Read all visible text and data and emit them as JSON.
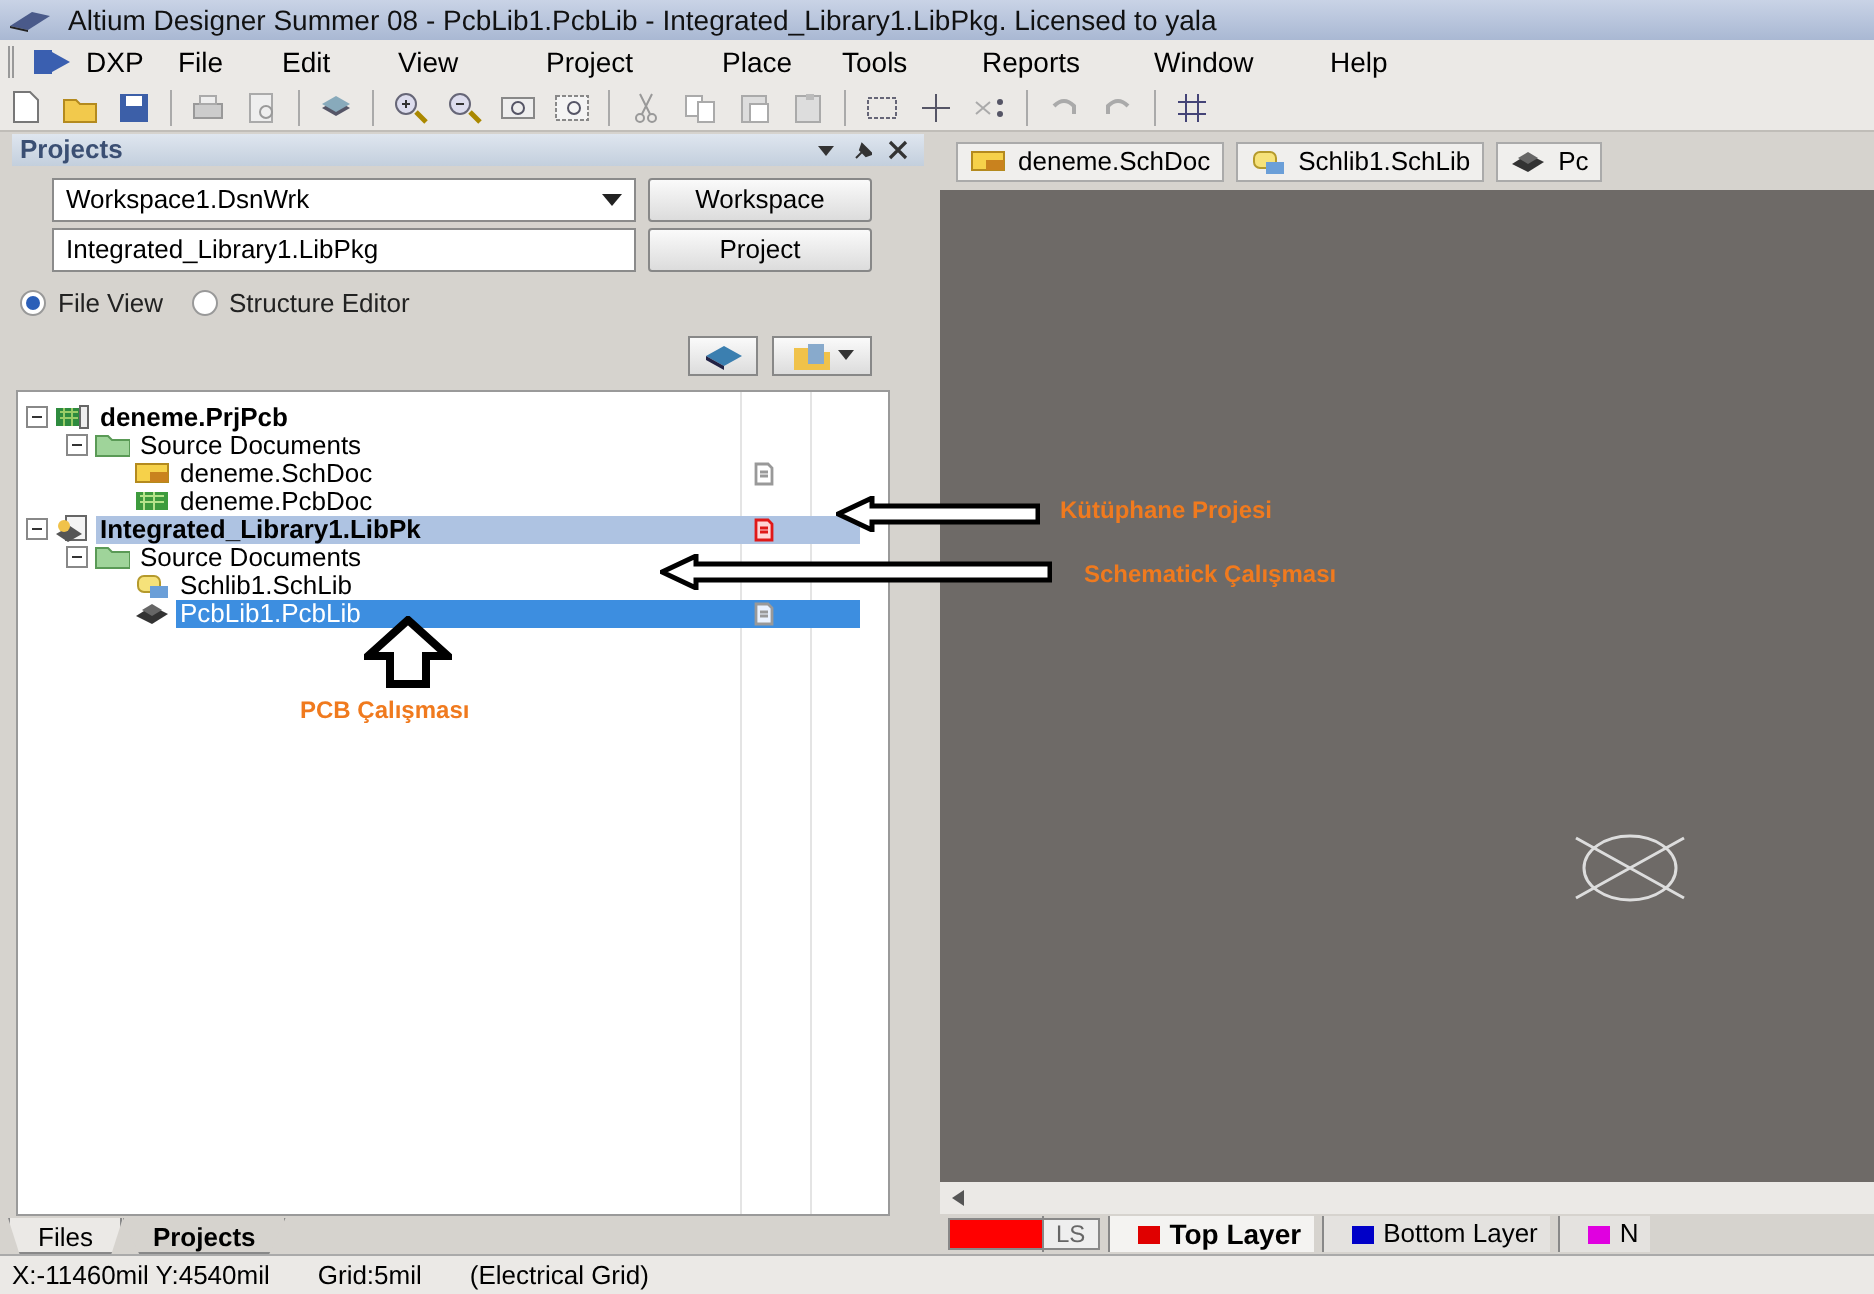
{
  "window": {
    "title": "Altium Designer Summer 08 - PcbLib1.PcbLib - Integrated_Library1.LibPkg. Licensed to yala"
  },
  "menu": [
    "DXP",
    "File",
    "Edit",
    "View",
    "Project",
    "Place",
    "Tools",
    "Reports",
    "Window",
    "Help"
  ],
  "panel": {
    "title": "Projects",
    "workspace_field": "Workspace1.DsnWrk",
    "workspace_button": "Workspace",
    "project_field": "Integrated_Library1.LibPkg",
    "project_button": "Project",
    "view_options": [
      {
        "label": "File View",
        "selected": true
      },
      {
        "label": "Structure Editor",
        "selected": false
      }
    ],
    "tree": [
      {
        "label": "deneme.PrjPcb",
        "kind": "pcb-project",
        "bold": true,
        "expanded": true,
        "selected": false,
        "highlighted": false,
        "open": false,
        "modified": false,
        "children": [
          {
            "label": "Source Documents",
            "kind": "folder",
            "bold": false,
            "expanded": true,
            "selected": false,
            "highlighted": false,
            "open": false,
            "modified": false,
            "children": [
              {
                "label": "deneme.SchDoc",
                "kind": "schdoc",
                "bold": false,
                "selected": false,
                "highlighted": false,
                "open": true,
                "modified": false
              },
              {
                "label": "deneme.PcbDoc",
                "kind": "pcbdoc",
                "bold": false,
                "selected": false,
                "highlighted": false,
                "open": false,
                "modified": false
              }
            ]
          }
        ]
      },
      {
        "label": "Integrated_Library1.LibPk",
        "kind": "lib-project",
        "bold": true,
        "expanded": true,
        "selected": false,
        "highlighted": true,
        "open": true,
        "modified": true,
        "children": [
          {
            "label": "Source Documents",
            "kind": "folder",
            "bold": false,
            "expanded": true,
            "selected": false,
            "highlighted": false,
            "open": false,
            "modified": false,
            "children": [
              {
                "label": "Schlib1.SchLib",
                "kind": "schlib",
                "bold": false,
                "selected": false,
                "highlighted": false,
                "open": false,
                "modified": false
              },
              {
                "label": "PcbLib1.PcbLib",
                "kind": "pcblib",
                "bold": false,
                "selected": true,
                "highlighted": false,
                "open": true,
                "modified": false
              }
            ]
          }
        ]
      }
    ]
  },
  "panel_tabs": [
    {
      "label": "Files",
      "selected": false
    },
    {
      "label": "Projects",
      "selected": true
    }
  ],
  "document_tabs": [
    {
      "label": "deneme.SchDoc",
      "kind": "schdoc"
    },
    {
      "label": "Schlib1.SchLib",
      "kind": "schlib"
    },
    {
      "label": "Pc",
      "kind": "pcblib"
    }
  ],
  "layer_tabs": [
    {
      "label": "Top Layer",
      "color": "#e00000",
      "selected": true
    },
    {
      "label": "Bottom Layer",
      "color": "#0000c8",
      "selected": false
    },
    {
      "label": "N",
      "color": "#e000e0",
      "selected": false
    }
  ],
  "layer_set": {
    "label": "LS",
    "color": "#ff0000"
  },
  "status_bar": [
    "X:-11460mil Y:4540mil",
    "Grid:5mil",
    "(Electrical Grid)"
  ],
  "annotations": [
    {
      "label": "Kütüphane Projesi",
      "kind": "left-arrow"
    },
    {
      "label": "Schematick Çalışması",
      "kind": "left-arrow"
    },
    {
      "label": "PCB Çalışması",
      "kind": "up-arrow"
    }
  ]
}
